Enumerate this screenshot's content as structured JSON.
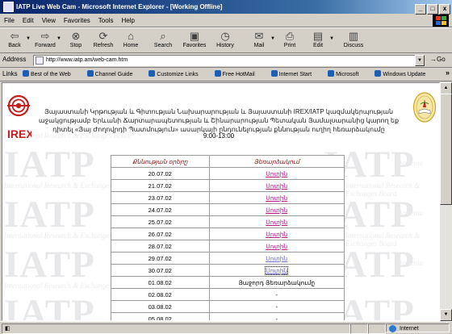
{
  "window": {
    "title": "IATP Live Web Cam - Microsoft Internet Explorer - [Working Offline]",
    "controls": [
      "_",
      "□",
      "x"
    ]
  },
  "menu": [
    "File",
    "Edit",
    "View",
    "Favorites",
    "Tools",
    "Help"
  ],
  "toolbar": {
    "back": "Back",
    "forward": "Forward",
    "stop": "Stop",
    "refresh": "Refresh",
    "home": "Home",
    "search": "Search",
    "favorites": "Favorites",
    "history": "History",
    "mail": "Mail",
    "print": "Print",
    "edit": "Edit",
    "discuss": "Discuss"
  },
  "address": {
    "label": "Address",
    "url": "http://www.iatp.am/web-cam.htm",
    "go": "Go"
  },
  "links": {
    "label": "Links",
    "items": [
      "Best of the Web",
      "Channel Guide",
      "Customize Links",
      "Free HotMail",
      "Internet Start",
      "Microsoft",
      "Windows Update"
    ]
  },
  "page": {
    "logo_text": "IREX",
    "intro": "Յայաստանի Կրթության և Գիտության Նախարարության և Յայաստանի IREX/IATP կազմակերպության աջակցությամբ Երևանի Ճարտարապետության և Շինարարության Պետական Յամալսարանից կարող եք դիտել «Յայ Ժողովրդի Պատմություն» ասարկայի ընդունելության քննության ուղիղ հեռարձակումը",
    "hours": "9:00-13:00",
    "table": {
      "headers": [
        "Քննության օրերը",
        "Յեռարձակում"
      ],
      "rows": [
        {
          "date": "20.07.02",
          "status": "Սոտին",
          "style": "link"
        },
        {
          "date": "21.07.02",
          "status": "Սոտին",
          "style": "link"
        },
        {
          "date": "23.07.02",
          "status": "Սոտին",
          "style": "link"
        },
        {
          "date": "24.07.02",
          "status": "Սոտին",
          "style": "link"
        },
        {
          "date": "25.07.02",
          "status": "Սոտին",
          "style": "link"
        },
        {
          "date": "26.07.02",
          "status": "Սոտին",
          "style": "link"
        },
        {
          "date": "28.07.02",
          "status": "Սոտին",
          "style": "link"
        },
        {
          "date": "29.07.02",
          "status": "Սոտին",
          "style": "visited"
        },
        {
          "date": "30.07.02",
          "status": "Սոտին",
          "style": "focus"
        },
        {
          "date": "01.08.02",
          "status": "Յաջորդ Յեռարձակումը",
          "style": "text"
        },
        {
          "date": "02.08.02",
          "status": "-",
          "style": "text"
        },
        {
          "date": "03.08.02",
          "status": "-",
          "style": "text"
        },
        {
          "date": "05.08.02",
          "status": "-",
          "style": "text"
        }
      ]
    },
    "watermark": {
      "word": "IATP",
      "suffix": "Armenia",
      "phrase": "International Research & Exchanges Board"
    }
  },
  "status": {
    "zone": "Internet"
  },
  "colors": {
    "title_gradient_start": "#0a246a",
    "link": "#c0178a",
    "visited_link": "#6b6bd6",
    "header_text": "#8b1010",
    "irex_red": "#c41e1e"
  }
}
